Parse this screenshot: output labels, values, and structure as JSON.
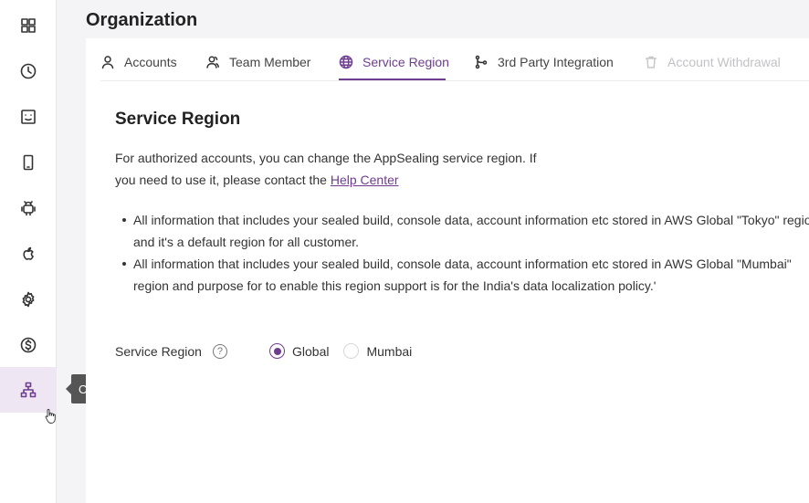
{
  "page": {
    "title": "Organization"
  },
  "sidebar": {
    "items": [
      {
        "icon": "dashboard-grid-icon"
      },
      {
        "icon": "clock-icon"
      },
      {
        "icon": "report-icon"
      },
      {
        "icon": "mobile-device-icon"
      },
      {
        "icon": "android-icon"
      },
      {
        "icon": "apple-icon"
      },
      {
        "icon": "gear-icon"
      },
      {
        "icon": "dollar-icon"
      },
      {
        "icon": "organization-icon",
        "active": true
      }
    ],
    "tooltip": "Organization"
  },
  "tabs": [
    {
      "label": "Accounts",
      "icon": "user-icon"
    },
    {
      "label": "Team Member",
      "icon": "team-icon"
    },
    {
      "label": "Service Region",
      "icon": "globe-icon",
      "active": true
    },
    {
      "label": "3rd Party Integration",
      "icon": "branch-icon"
    },
    {
      "label": "Account Withdrawal",
      "icon": "trash-icon",
      "disabled": true
    }
  ],
  "content": {
    "title": "Service Region",
    "desc_line1": "For authorized accounts, you can change the AppSealing service region. If",
    "desc_line2_prefix": "you need to use it, please contact the ",
    "help_link": "Help Center",
    "bullets": [
      {
        "line1": "All information that includes your sealed build, console data, account information etc stored in AWS Global \"Tokyo\" region",
        "line2": "and it's a default region for all customer."
      },
      {
        "line1": "All information that includes your sealed build, console data, account information etc stored in AWS Global \"Mumbai\"",
        "line2": "region and purpose for to enable this region support is for the India's data localization policy.'"
      }
    ],
    "region_label": "Service Region",
    "help_icon_glyph": "?",
    "options": [
      {
        "label": "Global",
        "selected": true
      },
      {
        "label": "Mumbai",
        "selected": false
      }
    ]
  },
  "colors": {
    "accent": "#6f3d8f",
    "active_bg": "#efe6f3",
    "tooltip_bg": "#555555"
  }
}
